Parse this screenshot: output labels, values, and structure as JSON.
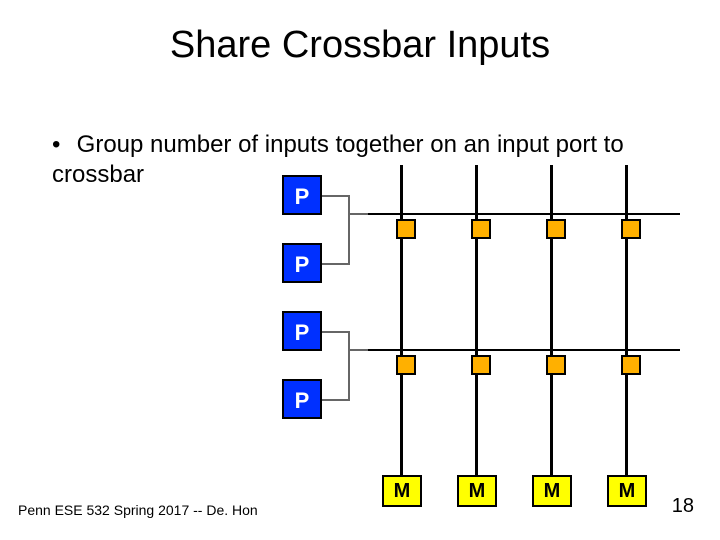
{
  "title": "Share Crossbar Inputs",
  "bullet_text": "Group number of inputs together on an input port to crossbar",
  "footer": "Penn ESE 532 Spring 2017 -- De. Hon",
  "page_number": "18",
  "p_labels": [
    "P",
    "P",
    "P",
    "P"
  ],
  "m_labels": [
    "M",
    "M",
    "M",
    "M"
  ],
  "chart_data": {
    "type": "diagram",
    "title": "Share Crossbar Inputs",
    "description": "Crossbar with grouped inputs: 4 processor ports P on left (grouped in pairs feeding 2 horizontal crossbar lines), 4 memory ports M on bottom as vertical lines, orange squares mark crosspoint switches.",
    "processors": [
      "P",
      "P",
      "P",
      "P"
    ],
    "memories": [
      "M",
      "M",
      "M",
      "M"
    ],
    "horizontal_rows_from_grouped_pairs": 2,
    "crosspoints_per_row": 4
  }
}
